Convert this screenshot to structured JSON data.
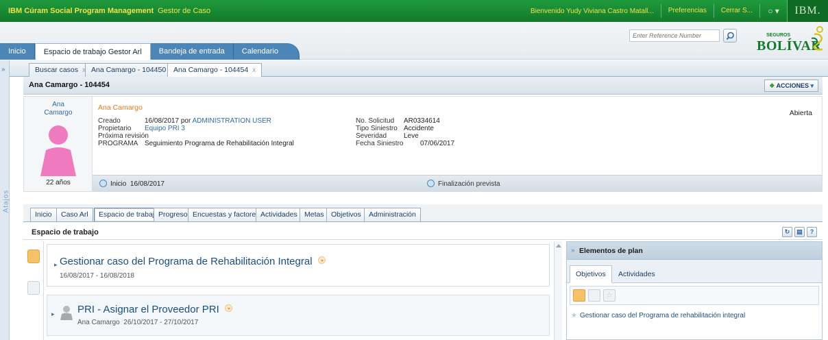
{
  "topbar": {
    "brand": "IBM Cúram Social Program Management",
    "module": "Gestor de Caso",
    "welcome": "Bienvenido Yudy Viviana Castro Matall...",
    "preferences": "Preferencias",
    "logout": "Cerrar S...",
    "help_icon": "help-icon",
    "ibm_logo": "IBM."
  },
  "header": {
    "ref_placeholder": "Enter Reference Number",
    "logo_small": "SEGUROS",
    "logo_big": "BOLÍVAR"
  },
  "main_tabs": {
    "home": "Inicio",
    "workspace": "Espacio de trabajo Gestor Arl",
    "inbox": "Bandeja de entrada",
    "calendar": "Calendario"
  },
  "side": {
    "shortcuts": "Atajos"
  },
  "content_tabs": [
    {
      "label": "Buscar casos",
      "close": "x"
    },
    {
      "label": "Ana Camargo - 104450",
      "close": "x"
    },
    {
      "label": "Ana Camargo - 104454",
      "close": "x"
    }
  ],
  "case": {
    "title": "Ana Camargo - 104454",
    "actions": "ACCIONES",
    "person_first": "Ana",
    "person_last": "Camargo",
    "age": "22 años",
    "person_name": "Ana Camargo",
    "status": "Abierta",
    "created_label": "Creado",
    "created_value": "16/08/2017 por",
    "created_by": "ADMINISTRATION USER",
    "owner_label": "Propietario",
    "owner_value": "Equipo PRI 3",
    "next_review_label": "Próxima revisión",
    "program_label": "PROGRAMA",
    "program_value": "Seguimiento Programa de Rehabilitación Integral",
    "request_label": "No. Solicitud",
    "request_value": "AR0334614",
    "type_label": "Tipo Siniestro",
    "type_value": "Accidente",
    "severity_label": "Severidad",
    "severity_value": "Leve",
    "date_label": "Fecha Siniestro",
    "date_value": "07/06/2017",
    "start_label": "Inicio",
    "start_value": "16/08/2017",
    "end_label": "Finalización prevista"
  },
  "sub_tabs": [
    "Inicio",
    "Caso Arl",
    "Espacio de trabajo",
    "Progreso",
    "Encuestas y factores",
    "Actividades",
    "Metas",
    "Objetivos",
    "Administración"
  ],
  "workspace": {
    "title": "Espacio de trabajo",
    "plan1_title": "Gestionar caso del Programa de Rehabilitación Integral",
    "plan1_dates": "16/08/2017  -  16/08/2018",
    "plan2_title": "PRI - Asignar el Proveedor PRI",
    "plan2_person": "Ana Camargo",
    "plan2_dates": "26/10/2017  -  27/10/2017"
  },
  "plan_elements": {
    "title": "Elementos de plan",
    "tab_objectives": "Objetivos",
    "tab_activities": "Actividades",
    "item": "Gestionar caso del Programa de rehabilitación integral"
  },
  "colors": {
    "top_green": "#1f9a3c",
    "tab_blue": "#4c86b8",
    "accent_orange": "#e07a1c"
  }
}
